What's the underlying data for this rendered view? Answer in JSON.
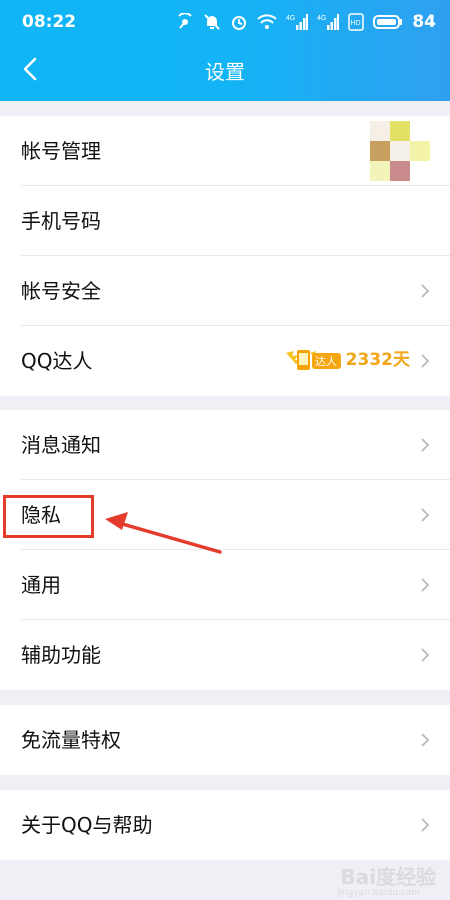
{
  "status_bar": {
    "time": "08:22",
    "signal_tag_1": "4G",
    "signal_tag_2": "4G",
    "hd_tag": "HD",
    "battery": "84"
  },
  "header": {
    "title": "设置",
    "back_icon": "chevron-left-icon"
  },
  "groups": [
    {
      "items": [
        {
          "label": "帐号管理",
          "right": "avatar"
        },
        {
          "label": "手机号码",
          "right": "none"
        },
        {
          "label": "帐号安全",
          "right": "chevron"
        },
        {
          "label": "QQ达人",
          "right": "daren",
          "badge_text": "达人",
          "value": "2332天"
        }
      ]
    },
    {
      "items": [
        {
          "label": "消息通知",
          "right": "chevron"
        },
        {
          "label": "隐私",
          "right": "chevron",
          "highlighted": true
        },
        {
          "label": "通用",
          "right": "chevron"
        },
        {
          "label": "辅助功能",
          "right": "chevron"
        }
      ]
    },
    {
      "items": [
        {
          "label": "免流量特权",
          "right": "chevron"
        }
      ]
    },
    {
      "items": [
        {
          "label": "关于QQ与帮助",
          "right": "chevron"
        }
      ]
    }
  ],
  "colors": {
    "header": "#12b4f5",
    "background": "#eef0f5",
    "annotation": "#e53b2d",
    "daren": "#f2a516"
  },
  "avatar_colors": [
    "#f5efe6",
    "#e3e066",
    "#ffffff",
    "#c79f5f",
    "#f5f0e8",
    "#f4f4a8",
    "#f2f4ba",
    "#c88a8a",
    "#ffffff"
  ],
  "watermark": {
    "main": "Bai度经验",
    "sub": "jingyan.baidu.com"
  }
}
